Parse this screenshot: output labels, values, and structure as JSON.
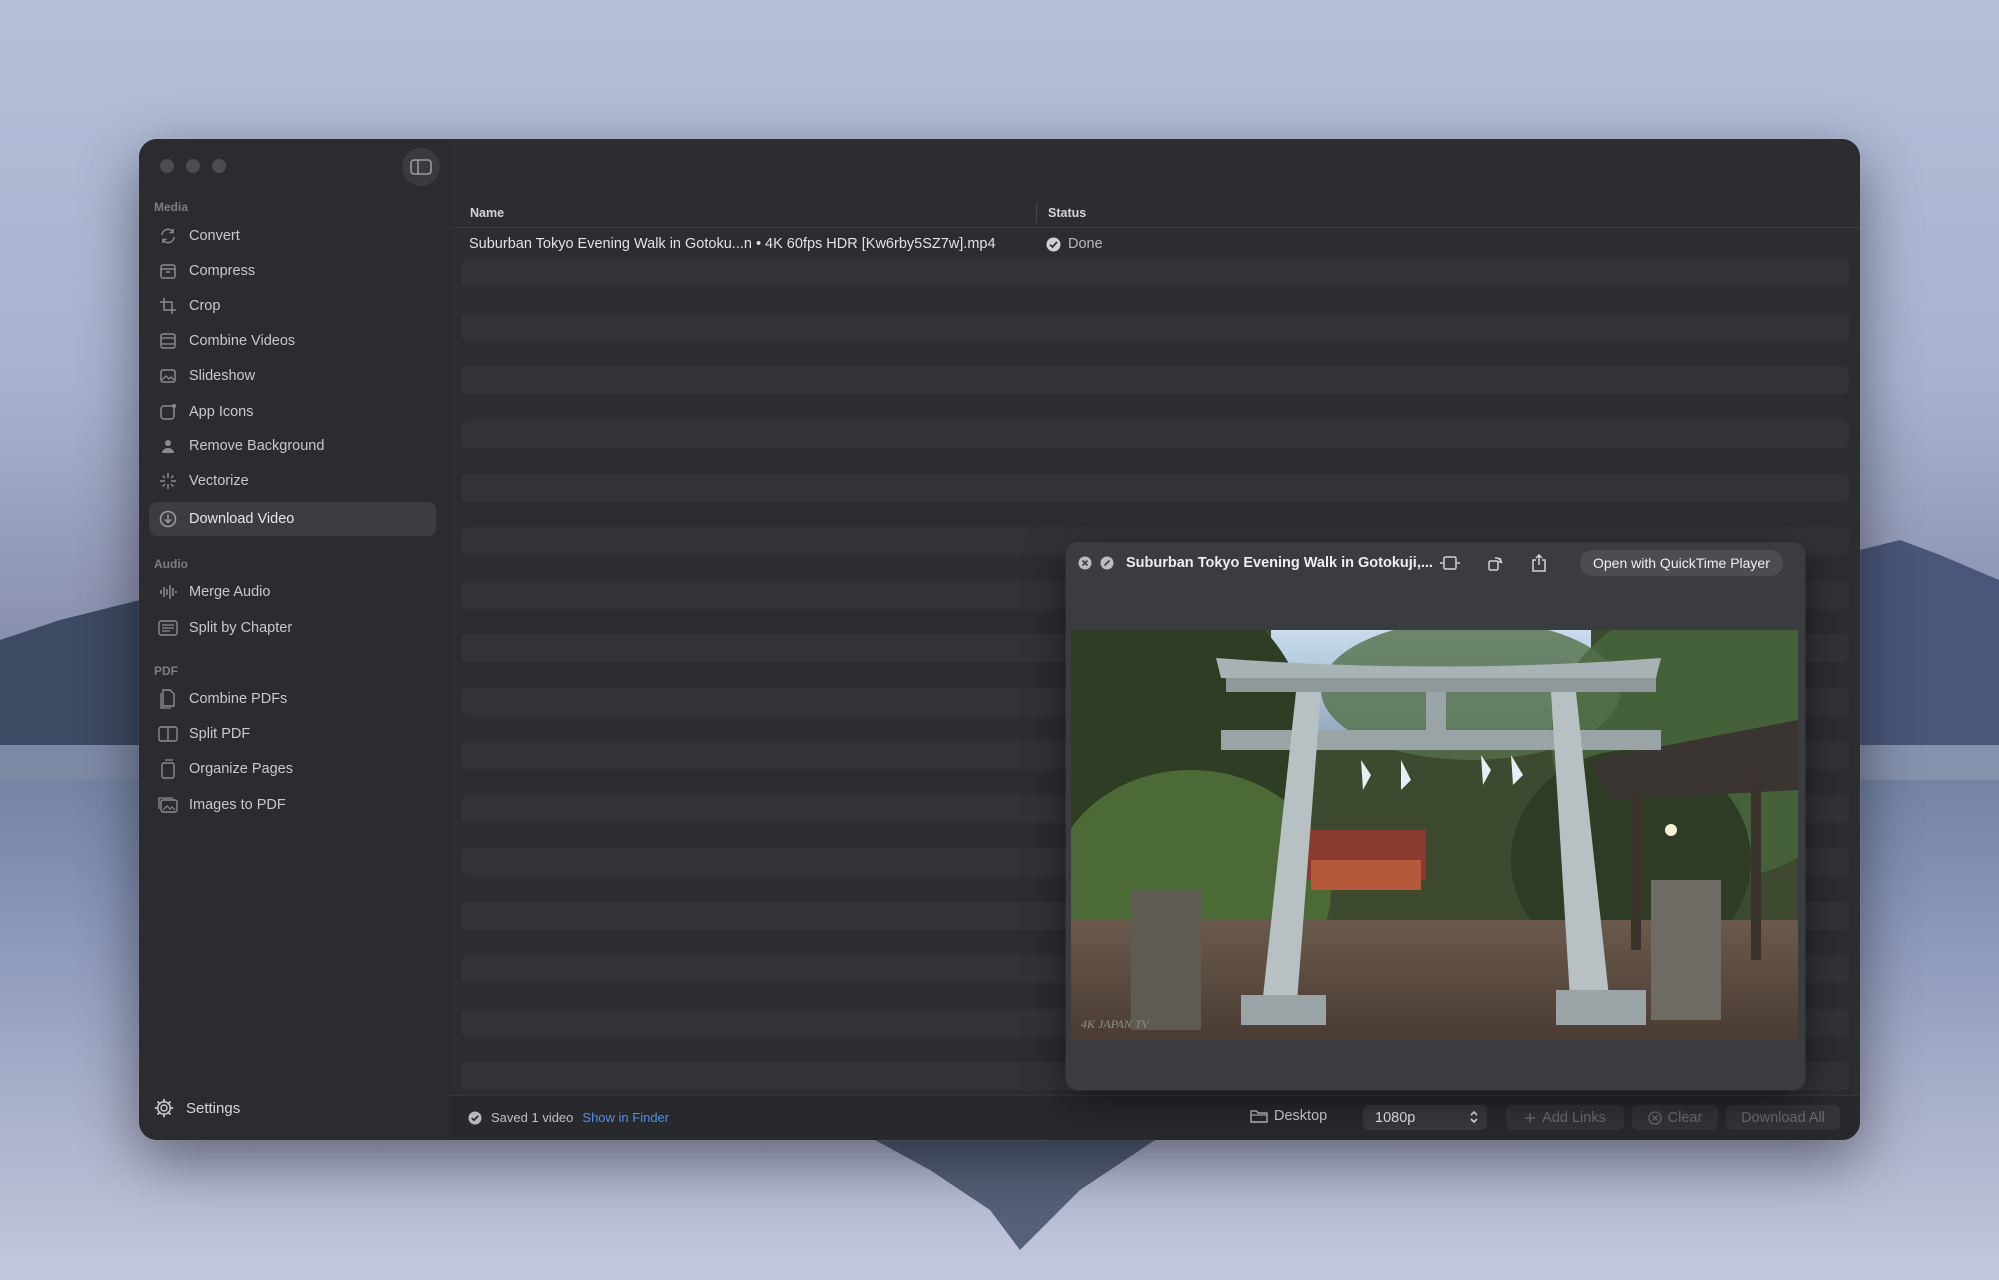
{
  "sidebar": {
    "sections": [
      {
        "label": "Media",
        "items": [
          {
            "label": "Convert",
            "icon": "convert-icon"
          },
          {
            "label": "Compress",
            "icon": "compress-icon"
          },
          {
            "label": "Crop",
            "icon": "crop-icon"
          },
          {
            "label": "Combine Videos",
            "icon": "film-icon"
          },
          {
            "label": "Slideshow",
            "icon": "photo-icon"
          },
          {
            "label": "App Icons",
            "icon": "app-icon"
          },
          {
            "label": "Remove Background",
            "icon": "person-icon"
          },
          {
            "label": "Vectorize",
            "icon": "sparkle-icon"
          },
          {
            "label": "Download Video",
            "icon": "download-icon",
            "active": true
          }
        ]
      },
      {
        "label": "Audio",
        "items": [
          {
            "label": "Merge Audio",
            "icon": "waveform-icon"
          },
          {
            "label": "Split by Chapter",
            "icon": "list-icon"
          }
        ]
      },
      {
        "label": "PDF",
        "items": [
          {
            "label": "Combine PDFs",
            "icon": "document-icon"
          },
          {
            "label": "Split PDF",
            "icon": "split-icon"
          },
          {
            "label": "Organize Pages",
            "icon": "pages-icon"
          },
          {
            "label": "Images to PDF",
            "icon": "images-icon"
          }
        ]
      }
    ],
    "settings_label": "Settings"
  },
  "table": {
    "columns": {
      "name": "Name",
      "status": "Status"
    },
    "rows": [
      {
        "name": "Suburban Tokyo Evening Walk in Gotoku...n • 4K 60fps HDR [Kw6rby5SZ7w].mp4",
        "status": "Done"
      }
    ]
  },
  "bottom_bar": {
    "saved_text": "Saved 1 video",
    "show_in_finder": "Show in Finder",
    "destination": "Desktop",
    "quality": "1080p",
    "add_links": "Add Links",
    "clear": "Clear",
    "download_all": "Download All"
  },
  "quicklook": {
    "title": "Suburban Tokyo Evening Walk in Gotokuji,...",
    "open_button": "Open with QuickTime Player",
    "watermark": "4K JAPAN TV"
  },
  "colors": {
    "accent_link": "#4f8ff0",
    "window_bg": "#2c2d31",
    "sidebar_bg": "#2b2c30"
  }
}
